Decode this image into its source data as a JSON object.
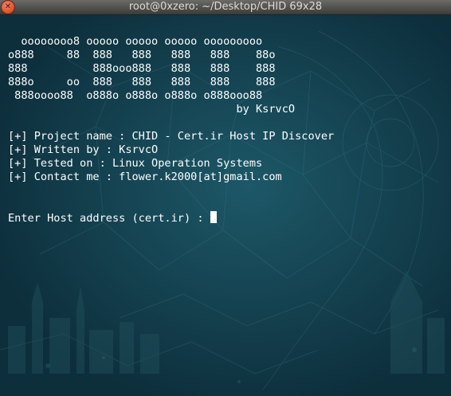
{
  "window": {
    "title": "root@0xzero: ~/Desktop/CHID 69x28",
    "close_glyph": "✕"
  },
  "banner": [
    "",
    "  oooooooo8 ooooo ooooo ooooo ooooooooo",
    "o888     88  888   888   888   888    88o",
    "888          888ooo888   888   888    888",
    "888o     oo  888   888   888   888    888",
    " 888oooo88  o888o o888o o888o o888ooo88",
    "                                   by KsrvcO"
  ],
  "info": [
    "[+] Project name : CHID - Cert.ir Host IP Discover",
    "[+] Written by : KsrvcO",
    "[+] Tested on : Linux Operation Systems",
    "[+] Contact me : flower.k2000[at]gmail.com"
  ],
  "prompt": {
    "text": "Enter Host address (cert.ir) : ",
    "input_value": ""
  },
  "colors": {
    "background": "#0f3442",
    "text": "#ffffff",
    "titlebar": "#3c3b37",
    "close_button": "#e3542b"
  }
}
